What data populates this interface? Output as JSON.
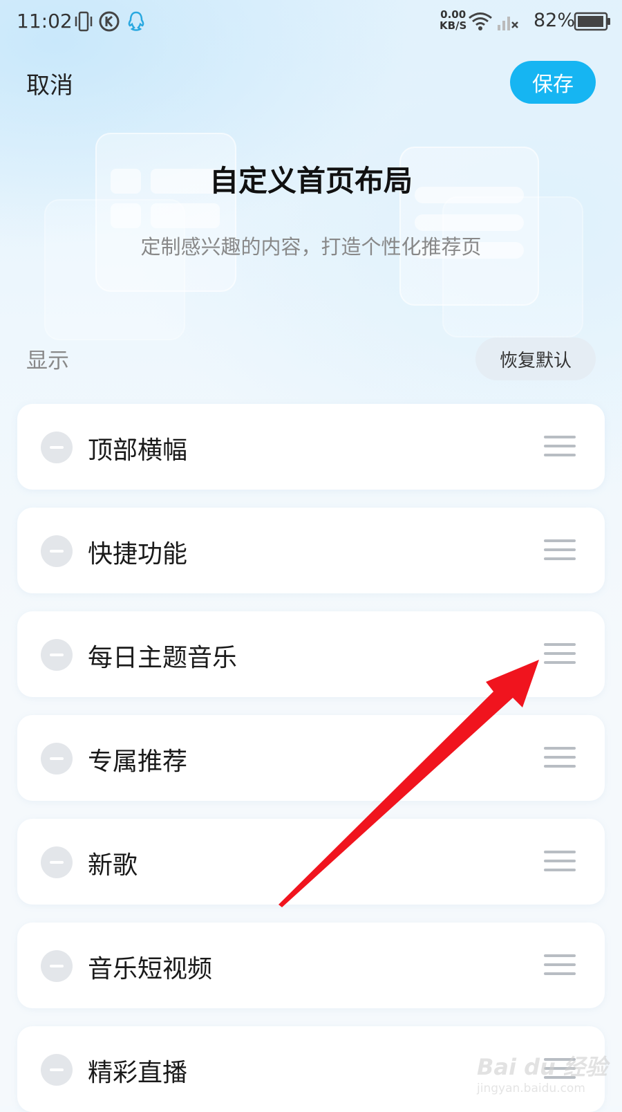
{
  "status_bar": {
    "time": "11:02",
    "net_speed_value": "0.00",
    "net_speed_unit": "KB/S",
    "battery_percent": "82%",
    "icons": [
      "vibrate-icon",
      "k-app-icon",
      "qq-icon",
      "wifi-icon",
      "signal-icon",
      "battery-icon"
    ]
  },
  "header": {
    "cancel_label": "取消",
    "save_label": "保存"
  },
  "hero": {
    "title": "自定义首页布局",
    "subtitle": "定制感兴趣的内容，打造个性化推荐页"
  },
  "section": {
    "label": "显示",
    "restore_label": "恢复默认"
  },
  "items": [
    {
      "label": "顶部横幅"
    },
    {
      "label": "快捷功能"
    },
    {
      "label": "每日主题音乐"
    },
    {
      "label": "专属推荐"
    },
    {
      "label": "新歌"
    },
    {
      "label": "音乐短视频"
    },
    {
      "label": "精彩直播"
    }
  ],
  "colors": {
    "accent": "#16b5f2",
    "annotation_arrow": "#f0141e"
  },
  "watermark": {
    "brand": "Bai du 经验",
    "url": "jingyan.baidu.com"
  }
}
